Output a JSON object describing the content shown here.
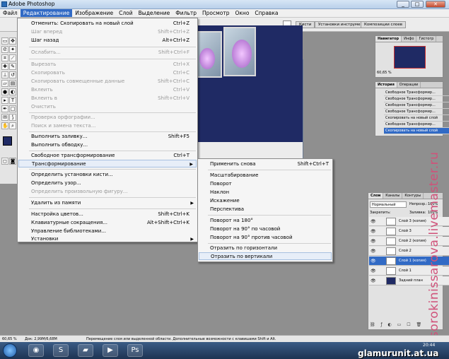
{
  "app": {
    "title": "Adobe Photoshop"
  },
  "window_buttons": [
    "_",
    "□",
    "✕"
  ],
  "menubar": [
    "Файл",
    "Редактирование",
    "Изображение",
    "Слой",
    "Выделение",
    "Фильтр",
    "Просмотр",
    "Окно",
    "Справка"
  ],
  "optionsbar": {
    "tabs": [
      "Кисти",
      "Установки инструментов",
      "Композиции слоев"
    ]
  },
  "edit_menu": {
    "items": [
      {
        "label": "Отменить: Скопировать на новый слой",
        "shortcut": "Ctrl+Z",
        "disabled": false
      },
      {
        "label": "Шаг вперед",
        "shortcut": "Shift+Ctrl+Z",
        "disabled": true
      },
      {
        "label": "Шаг назад",
        "shortcut": "Alt+Ctrl+Z",
        "disabled": false
      },
      {
        "label": "Ослабить...",
        "shortcut": "Shift+Ctrl+F",
        "disabled": true
      },
      {
        "label": "Вырезать",
        "shortcut": "Ctrl+X",
        "disabled": true
      },
      {
        "label": "Скопировать",
        "shortcut": "Ctrl+C",
        "disabled": true
      },
      {
        "label": "Скопировать совмещенные данные",
        "shortcut": "Shift+Ctrl+C",
        "disabled": true
      },
      {
        "label": "Вклеить",
        "shortcut": "Ctrl+V",
        "disabled": true
      },
      {
        "label": "Вклеить в",
        "shortcut": "Shift+Ctrl+V",
        "disabled": true
      },
      {
        "label": "Очистить",
        "shortcut": "",
        "disabled": true
      },
      {
        "label": "Проверка орфографии...",
        "shortcut": "",
        "disabled": true
      },
      {
        "label": "Поиск и замена текста...",
        "shortcut": "",
        "disabled": true
      },
      {
        "label": "Выполнить заливку...",
        "shortcut": "Shift+F5",
        "disabled": false
      },
      {
        "label": "Выполнить обводку...",
        "shortcut": "",
        "disabled": false
      },
      {
        "label": "Свободное трансформирование",
        "shortcut": "Ctrl+T",
        "disabled": false
      },
      {
        "label": "Трансформирование",
        "shortcut": "",
        "disabled": false
      },
      {
        "label": "Определить установки кисти...",
        "shortcut": "",
        "disabled": false
      },
      {
        "label": "Определить узор...",
        "shortcut": "",
        "disabled": false
      },
      {
        "label": "Определить произвольную фигуру...",
        "shortcut": "",
        "disabled": true
      },
      {
        "label": "Удалить из памяти",
        "shortcut": "",
        "disabled": false
      },
      {
        "label": "Настройка цветов...",
        "shortcut": "Shift+Ctrl+K",
        "disabled": false
      },
      {
        "label": "Клавиатурные сокращения...",
        "shortcut": "Alt+Shift+Ctrl+K",
        "disabled": false
      },
      {
        "label": "Управление библиотеками...",
        "shortcut": "",
        "disabled": false
      },
      {
        "label": "Установки",
        "shortcut": "",
        "disabled": false
      }
    ]
  },
  "transform_submenu": {
    "items": [
      {
        "label": "Применить снова",
        "shortcut": "Shift+Ctrl+T"
      },
      {
        "label": "Масштабирование",
        "shortcut": ""
      },
      {
        "label": "Поворот",
        "shortcut": ""
      },
      {
        "label": "Наклон",
        "shortcut": ""
      },
      {
        "label": "Искажение",
        "shortcut": ""
      },
      {
        "label": "Перспектива",
        "shortcut": ""
      },
      {
        "label": "Поворот на 180°",
        "shortcut": ""
      },
      {
        "label": "Поворот на 90° по часовой",
        "shortcut": ""
      },
      {
        "label": "Поворот на 90° против часовой",
        "shortcut": ""
      },
      {
        "label": "Отразить по горизонтали",
        "shortcut": ""
      },
      {
        "label": "Отразить по вертикали",
        "shortcut": ""
      }
    ]
  },
  "navigator": {
    "tabs": [
      "Навигатор",
      "Инфо",
      "Гистогр"
    ],
    "zoom": "60,65 %"
  },
  "history": {
    "tabs": [
      "История",
      "Операции"
    ],
    "items": [
      "Свободное Трансформир...",
      "Свободное Трансформир...",
      "Свободное Трансформир...",
      "Свободное Трансформир...",
      "Скопировать на новый слой",
      "Свободное Трансформир...",
      "Скопировать на новый слой"
    ]
  },
  "layers": {
    "tabs": [
      "Слои",
      "Каналы",
      "Контуры"
    ],
    "blend_mode": "Нормальный",
    "opacity_label": "Непрозр.:",
    "opacity_value": "100%",
    "lock_label": "Закрепить:",
    "fill_label": "Заливка:",
    "fill_value": "100%",
    "items": [
      "Слой 3 (копия)",
      "Слой 3",
      "Слой 2 (копия)",
      "Слой 2",
      "Слой 1 (копия)",
      "Слой 1",
      "Задний план"
    ]
  },
  "canvas_colors": {
    "background": "#1f2a64"
  },
  "statusbar": {
    "zoom": "60,65 %",
    "doc": "Док: 2,99M/6,68M",
    "hint": "Перемещение слоя или выделенной области. Дополнительные возможности с клавишами Shift и Alt."
  },
  "taskbar": {
    "time": "20:44"
  },
  "watermark": {
    "vertical": "sorokinissarova.livemaster.ru",
    "bottom": "glamurunit.at.ua"
  }
}
